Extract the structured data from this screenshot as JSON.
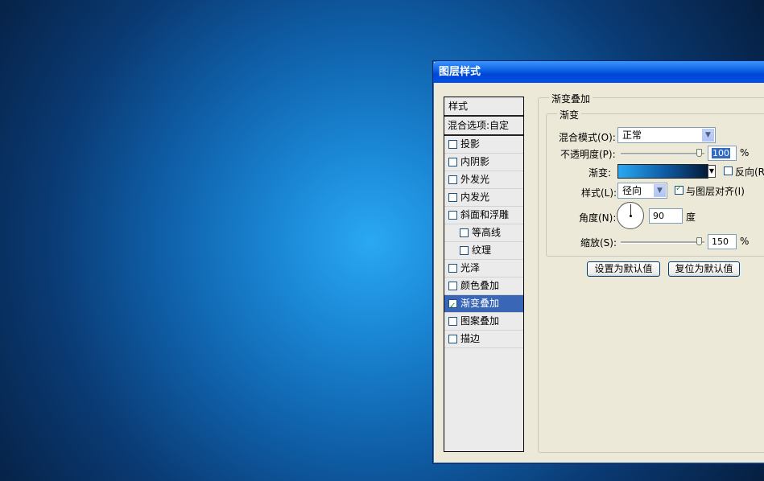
{
  "dialog": {
    "title": "图层样式"
  },
  "style_list": {
    "header": "样式",
    "blend_options": "混合选项:自定",
    "items": [
      {
        "label": "投影",
        "checked": false,
        "indent": false,
        "selected": false
      },
      {
        "label": "内阴影",
        "checked": false,
        "indent": false,
        "selected": false
      },
      {
        "label": "外发光",
        "checked": false,
        "indent": false,
        "selected": false
      },
      {
        "label": "内发光",
        "checked": false,
        "indent": false,
        "selected": false
      },
      {
        "label": "斜面和浮雕",
        "checked": false,
        "indent": false,
        "selected": false
      },
      {
        "label": "等高线",
        "checked": false,
        "indent": true,
        "selected": false
      },
      {
        "label": "纹理",
        "checked": false,
        "indent": true,
        "selected": false
      },
      {
        "label": "光泽",
        "checked": false,
        "indent": false,
        "selected": false
      },
      {
        "label": "颜色叠加",
        "checked": false,
        "indent": false,
        "selected": false
      },
      {
        "label": "渐变叠加",
        "checked": true,
        "indent": false,
        "selected": true
      },
      {
        "label": "图案叠加",
        "checked": false,
        "indent": false,
        "selected": false
      },
      {
        "label": "描边",
        "checked": false,
        "indent": false,
        "selected": false
      }
    ]
  },
  "panel": {
    "section_title": "渐变叠加",
    "group_title": "渐变",
    "blend_mode_label": "混合模式(O):",
    "blend_mode_value": "正常",
    "opacity_label": "不透明度(P):",
    "opacity_value": "100",
    "opacity_unit": "%",
    "opacity_level": 100,
    "gradient_label": "渐变:",
    "gradient_colors": [
      "#2aa8f2",
      "#0f5fa8",
      "#051a38"
    ],
    "reverse_label": "反向(R",
    "reverse_checked": false,
    "style_label": "样式(L):",
    "style_value": "径向",
    "align_label": "与图层对齐(I)",
    "align_checked": true,
    "angle_label": "角度(N):",
    "angle_value": "90",
    "angle_unit": "度",
    "scale_label": "缩放(S):",
    "scale_value": "150",
    "scale_unit": "%",
    "make_default_button": "设置为默认值",
    "reset_default_button": "复位为默认值"
  }
}
